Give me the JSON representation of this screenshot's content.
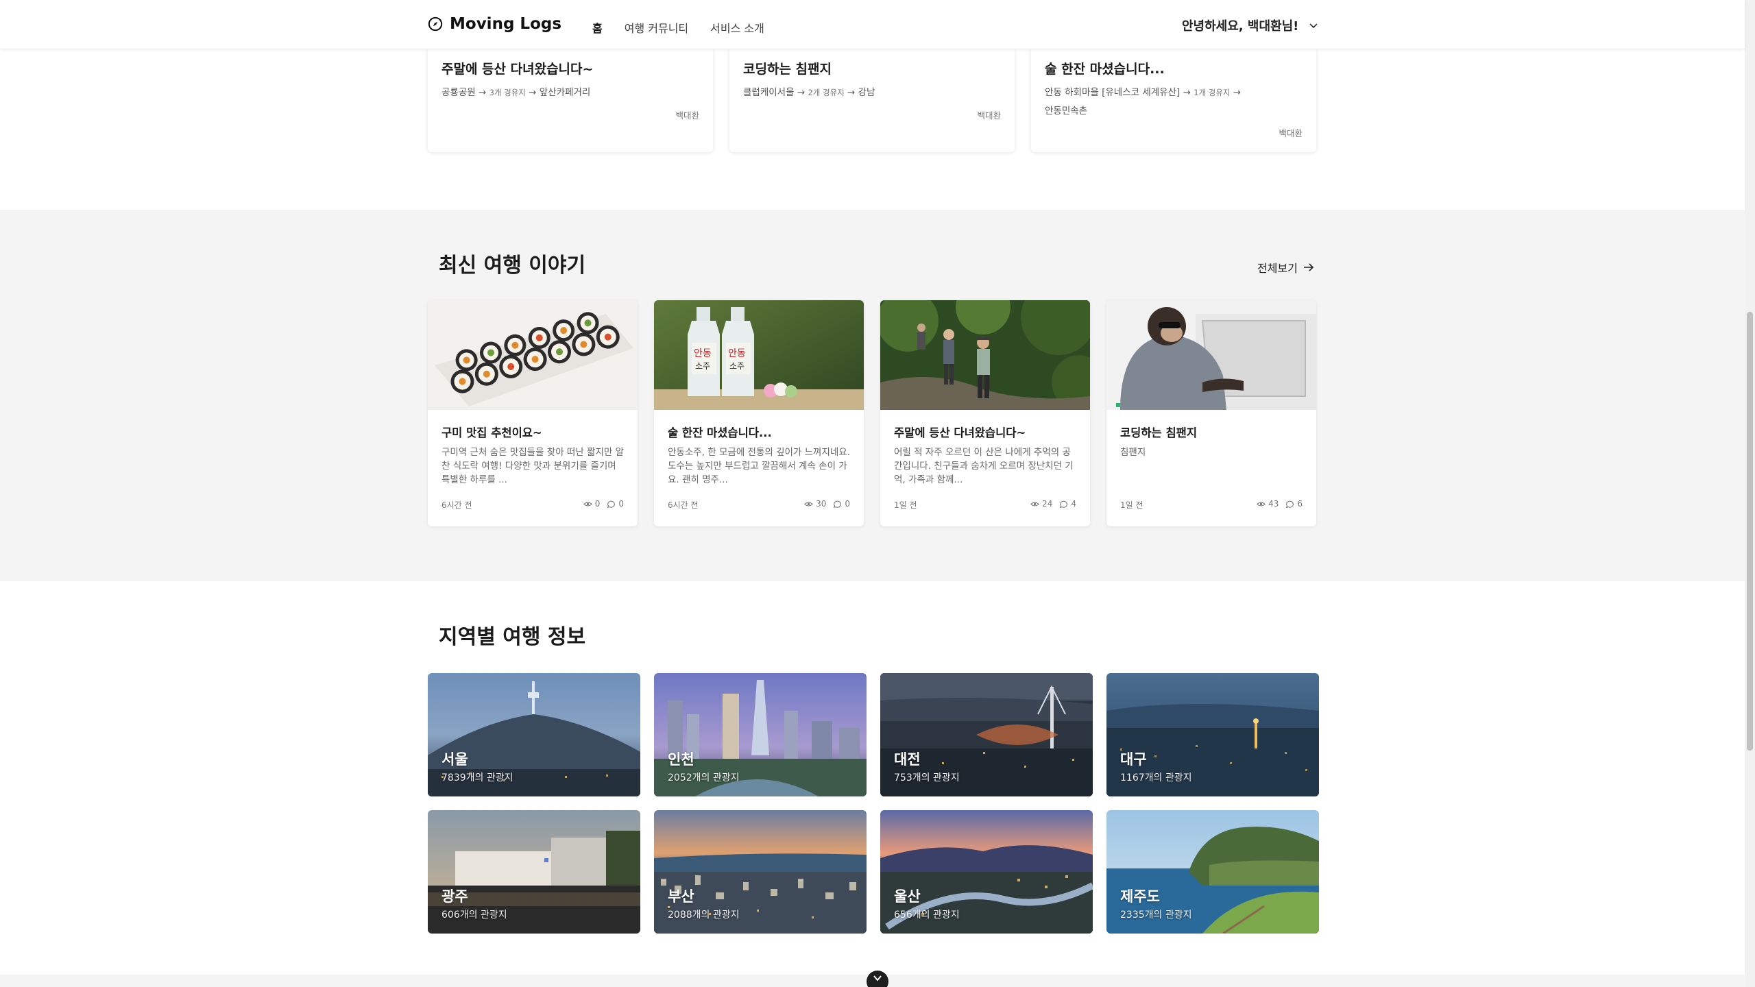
{
  "header": {
    "logo": "Moving Logs",
    "nav": [
      "홈",
      "여행 커뮤니티",
      "서비스 소개"
    ],
    "greeting": "안녕하세요, 백대환님!"
  },
  "top_cards": [
    {
      "title": "주말에 등산 다녀왔습니다~",
      "start": "공룡공원",
      "via": "3개 경유지",
      "end": "앞산카페거리",
      "author": "백대환"
    },
    {
      "title": "코딩하는 침팬지",
      "start": "클럽케이서울",
      "via": "2개 경유지",
      "end": "강남",
      "author": "백대환"
    },
    {
      "title": "술 한잔 마셨습니다...",
      "start": "안동 하회마을 [유네스코 세계유산]",
      "via": "1개 경유지",
      "end": "안동민속촌",
      "author": "백대환"
    }
  ],
  "latest": {
    "title": "최신 여행 이야기",
    "view_all": "전체보기",
    "stories": [
      {
        "title": "구미 맛집 추천이요~",
        "desc": "구미역 근처 숨은 맛집들을 찾아 떠난 짧지만 알찬 식도락 여행! 다양한 맛과 분위기를 즐기며 특별한 하루를 ...",
        "time": "6시간 전",
        "views": "0",
        "comments": "0"
      },
      {
        "title": "술 한잔 마셨습니다...",
        "desc": "안동소주, 한 모금에 전통의 깊이가 느껴지네요. 도수는 높지만 부드럽고 깔끔해서 계속 손이 가요. 괜히 명주...",
        "time": "6시간 전",
        "views": "30",
        "comments": "0"
      },
      {
        "title": "주말에 등산 다녀왔습니다~",
        "desc": "어릴 적 자주 오르던 이 산은 나에게 추억의 공간입니다. 친구들과 숨차게 오르며 장난치던 기억, 가족과 함께...",
        "time": "1일 전",
        "views": "24",
        "comments": "4"
      },
      {
        "title": "코딩하는 침팬지",
        "desc": "침팬지",
        "time": "1일 전",
        "views": "43",
        "comments": "6"
      }
    ]
  },
  "regions": {
    "title": "지역별 여행 정보",
    "items": [
      {
        "name": "서울",
        "count": "7839개의 관광지"
      },
      {
        "name": "인천",
        "count": "2052개의 관광지"
      },
      {
        "name": "대전",
        "count": "753개의 관광지"
      },
      {
        "name": "대구",
        "count": "1167개의 관광지"
      },
      {
        "name": "광주",
        "count": "606개의 관광지"
      },
      {
        "name": "부산",
        "count": "2088개의 관광지"
      },
      {
        "name": "울산",
        "count": "656개의 관광지"
      },
      {
        "name": "제주도",
        "count": "2335개의 관광지"
      }
    ]
  }
}
